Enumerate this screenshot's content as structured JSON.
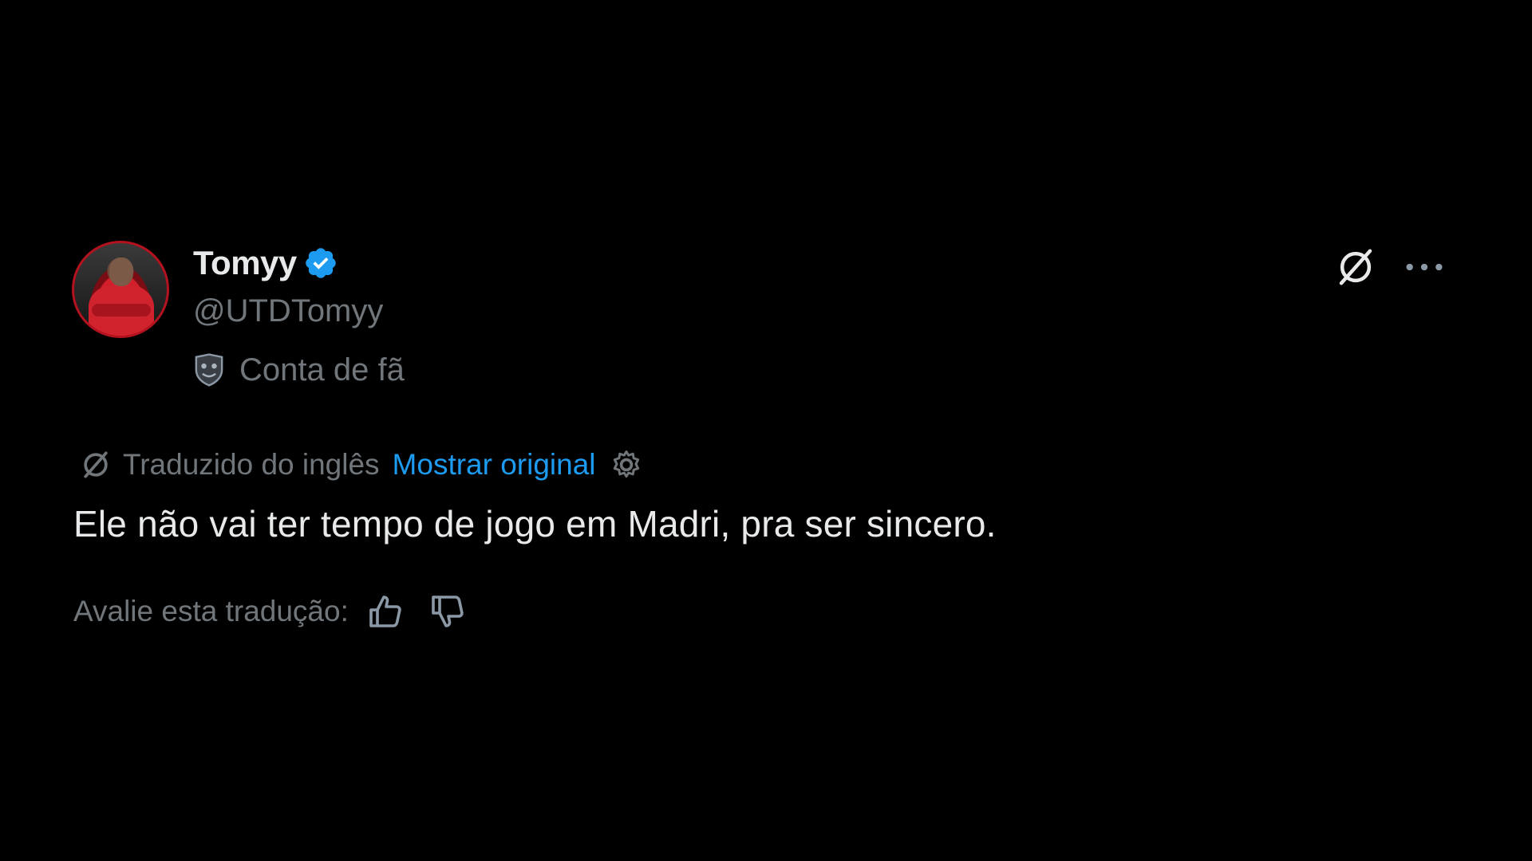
{
  "author": {
    "display_name": "Tomyy",
    "handle": "@UTDTomyy",
    "label": "Conta de fã",
    "verified_icon": "verified-badge-icon",
    "avatar_border_color": "#b3121f"
  },
  "translation": {
    "notice": "Traduzido do inglês",
    "show_original": "Mostrar original",
    "link_color": "#1d9bf0"
  },
  "tweet": {
    "text": "Ele não vai ter tempo de jogo em Madri, pra ser sincero."
  },
  "rating": {
    "prompt": "Avalie esta tradução:"
  },
  "icons": [
    "grok-icon",
    "more-icon",
    "translate-icon",
    "gear-icon",
    "thumbs-up-icon",
    "thumbs-down-icon",
    "shield-icon"
  ]
}
